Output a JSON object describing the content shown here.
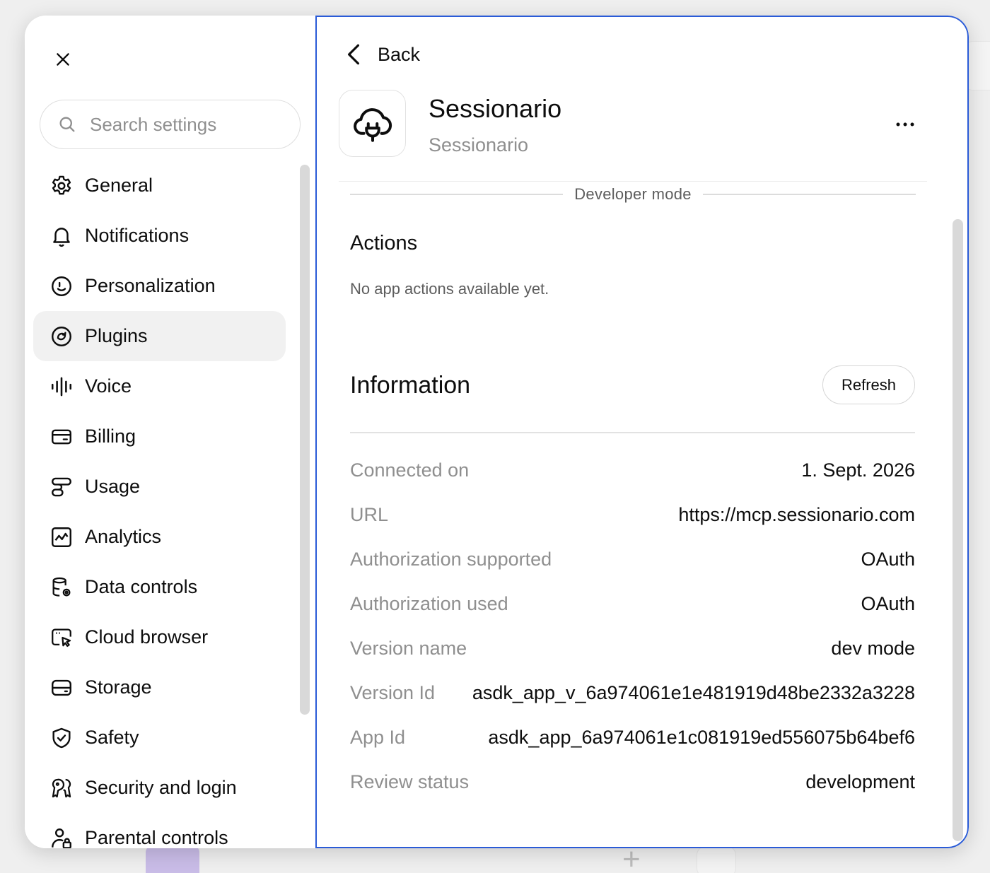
{
  "sidebar": {
    "search_placeholder": "Search settings",
    "items": [
      {
        "label": "General",
        "icon": "gear-icon"
      },
      {
        "label": "Notifications",
        "icon": "bell-icon"
      },
      {
        "label": "Personalization",
        "icon": "smile-icon"
      },
      {
        "label": "Plugins",
        "icon": "plugins-icon",
        "active": true
      },
      {
        "label": "Voice",
        "icon": "voice-waveform-icon"
      },
      {
        "label": "Billing",
        "icon": "credit-card-icon"
      },
      {
        "label": "Usage",
        "icon": "usage-icon"
      },
      {
        "label": "Analytics",
        "icon": "analytics-icon"
      },
      {
        "label": "Data controls",
        "icon": "database-gear-icon"
      },
      {
        "label": "Cloud browser",
        "icon": "cloud-browser-icon"
      },
      {
        "label": "Storage",
        "icon": "storage-icon"
      },
      {
        "label": "Safety",
        "icon": "shield-check-icon"
      },
      {
        "label": "Security and login",
        "icon": "security-icon"
      },
      {
        "label": "Parental controls",
        "icon": "parental-controls-icon"
      }
    ]
  },
  "main": {
    "back_label": "Back",
    "app_name": "Sessionario",
    "app_subtitle": "Sessionario",
    "divider_label": "Developer mode",
    "actions_title": "Actions",
    "actions_empty": "No app actions available yet.",
    "info_title": "Information",
    "refresh_label": "Refresh",
    "info": [
      {
        "key": "Connected on",
        "value": "1. Sept. 2026"
      },
      {
        "key": "URL",
        "value": "https://mcp.sessionario.com"
      },
      {
        "key": "Authorization supported",
        "value": "OAuth"
      },
      {
        "key": "Authorization used",
        "value": "OAuth"
      },
      {
        "key": "Version name",
        "value": "dev mode"
      },
      {
        "key": "Version Id",
        "value": "asdk_app_v_6a974061e1e481919d48be2332a3228"
      },
      {
        "key": "App Id",
        "value": "asdk_app_6a974061e1c081919ed556075b64bef6"
      },
      {
        "key": "Review status",
        "value": "development"
      }
    ]
  },
  "colors": {
    "accent_border": "#2a5bd7",
    "muted_text": "#8f8f8f",
    "active_bg": "#f1f1f1"
  }
}
